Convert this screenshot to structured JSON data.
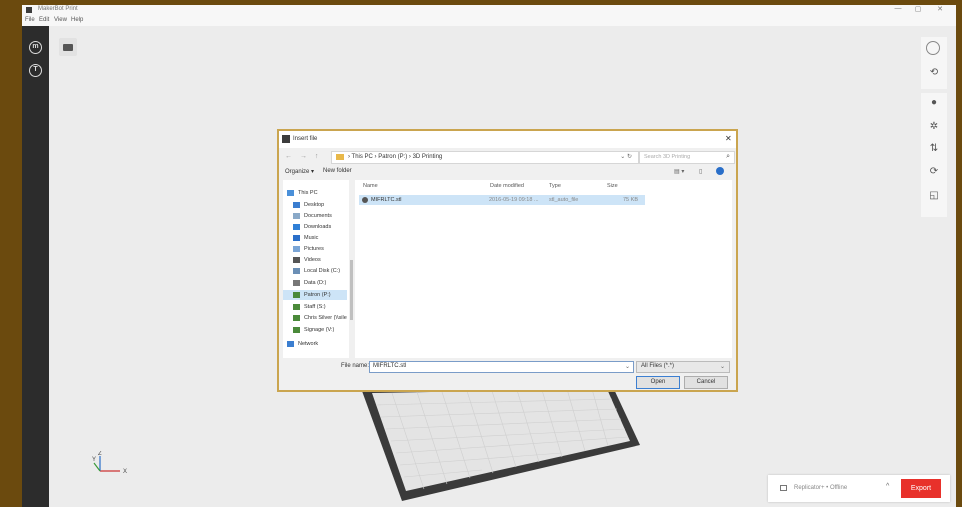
{
  "window": {
    "title": "MakerBot Print",
    "minimize": "—",
    "maximize": "▢",
    "close": "✕"
  },
  "menubar": {
    "items": [
      "File",
      "Edit",
      "View",
      "Help"
    ]
  },
  "dialog": {
    "title": "Insert file",
    "close": "✕",
    "nav_arrows": "← → ↑",
    "address": {
      "path": "› This PC › Patron (P:) › 3D Printing",
      "dropdown": "⌄ ↻"
    },
    "search": {
      "placeholder": "Search 3D Printing",
      "icon": "⌕"
    },
    "commands": {
      "organize": "Organize ▾",
      "new_folder": "New folder"
    },
    "nav_items": [
      {
        "label": "This PC",
        "icon": "computer-icon",
        "color": "#4a90d9"
      },
      {
        "label": "Desktop",
        "icon": "desktop-icon",
        "color": "#3b7ed0"
      },
      {
        "label": "Documents",
        "icon": "documents-icon",
        "color": "#8aa9c8"
      },
      {
        "label": "Downloads",
        "icon": "downloads-icon",
        "color": "#2f7fd6"
      },
      {
        "label": "Music",
        "icon": "music-icon",
        "color": "#2a6fc9"
      },
      {
        "label": "Pictures",
        "icon": "pictures-icon",
        "color": "#7aa5d6"
      },
      {
        "label": "Videos",
        "icon": "videos-icon",
        "color": "#555555"
      },
      {
        "label": "Local Disk (C:)",
        "icon": "disk-icon",
        "color": "#6b8fb5"
      },
      {
        "label": "Data (D:)",
        "icon": "drive-icon",
        "color": "#777777"
      },
      {
        "label": "Patron (P:)",
        "icon": "network-drive-icon",
        "color": "#4a8a3a",
        "selected": true
      },
      {
        "label": "Staff (S:)",
        "icon": "network-drive-icon",
        "color": "#4a8a3a"
      },
      {
        "label": "Chris Silver (\\\\sile",
        "icon": "network-drive-icon",
        "color": "#4a8a3a"
      },
      {
        "label": "Signage (V:)",
        "icon": "network-drive-icon",
        "color": "#4a8a3a"
      },
      {
        "label": "Network",
        "icon": "network-icon",
        "color": "#3b7ed0"
      }
    ],
    "columns": {
      "name": "Name",
      "date": "Date modified",
      "type": "Type",
      "size": "Size"
    },
    "files": [
      {
        "name": "MIFRLTC.stl",
        "date": "2016-05-19 09:18 ...",
        "type": "stl_auto_file",
        "size": "75 KB"
      }
    ],
    "file_name_label": "File name:",
    "file_name_value": "MIFRLTC.stl",
    "file_type": "All Files (*.*)",
    "open_label": "Open",
    "cancel_label": "Cancel"
  },
  "axes": {
    "x": "X",
    "y": "Y",
    "z": "Z"
  },
  "printer": {
    "status": "Replicator+ • Offline",
    "chevron": "^",
    "export_label": "Export"
  }
}
